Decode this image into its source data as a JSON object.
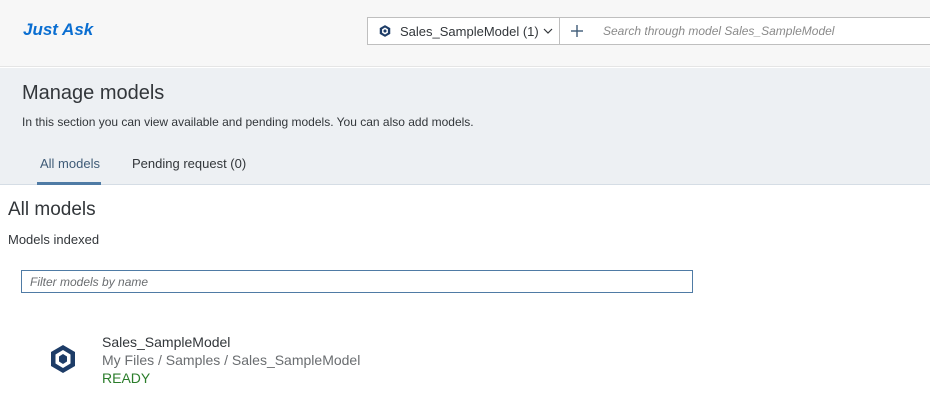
{
  "app": {
    "title": "Just Ask"
  },
  "searchbar": {
    "model_selector": "Sales_SampleModel (1)",
    "placeholder": "Search through model Sales_SampleModel"
  },
  "header": {
    "title": "Manage models",
    "description": "In this section you can view available and pending models. You can also add models.",
    "tabs": [
      {
        "label": "All models",
        "selected": true
      },
      {
        "label": "Pending request (0)",
        "selected": false
      }
    ]
  },
  "main": {
    "title": "All models",
    "subtitle": "Models indexed",
    "filter_placeholder": "Filter models by name",
    "models": [
      {
        "name": "Sales_SampleModel",
        "path": "My Files / Samples / Sales_SampleModel",
        "status": "READY"
      }
    ]
  },
  "colors": {
    "accent": "#0a6ed1",
    "icon": "#1d3c67",
    "status_ready": "#2b7d2b",
    "tab_indicator": "#4f7ba5"
  },
  "icons": {
    "model": "cube-icon",
    "dropdown": "chevron-down-icon",
    "add": "plus-icon"
  }
}
